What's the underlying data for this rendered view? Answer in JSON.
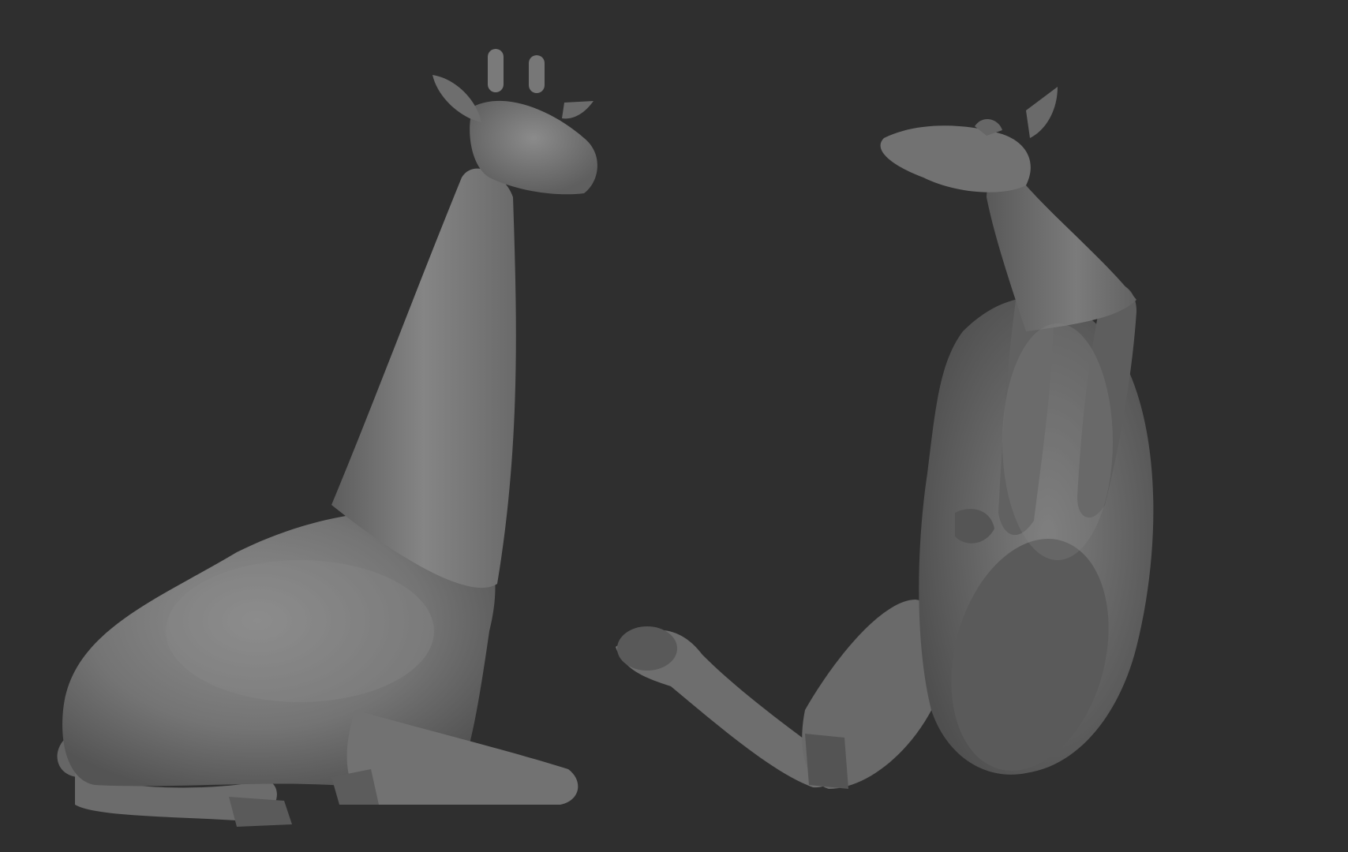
{
  "scene": {
    "background_color": "#2f2f2f",
    "clay_color": "#7a7a7a",
    "subjects": [
      {
        "name": "giraffe-sculpt-front"
      },
      {
        "name": "giraffe-sculpt-underside"
      }
    ]
  }
}
